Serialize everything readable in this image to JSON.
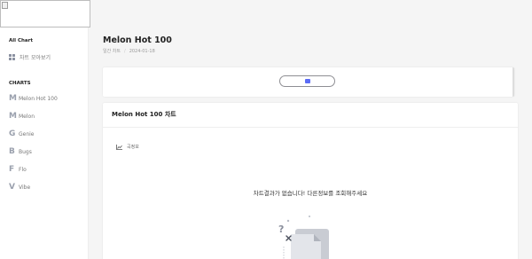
{
  "sidebar": {
    "all_chart_heading": "All Chart",
    "chart_overview_label": "차트 모아보기",
    "charts_heading": "CHARTS",
    "items": [
      {
        "letter": "M",
        "label": "Melon Hot 100"
      },
      {
        "letter": "M",
        "label": "Melon"
      },
      {
        "letter": "G",
        "label": "Genie"
      },
      {
        "letter": "B",
        "label": "Bugs"
      },
      {
        "letter": "F",
        "label": "Flo"
      },
      {
        "letter": "V",
        "label": "Vibe"
      }
    ]
  },
  "header": {
    "title": "Melon Hot 100",
    "breadcrumb_type": "일간 차트",
    "breadcrumb_date": "2024-01-18"
  },
  "chart_card": {
    "title": "Melon Hot 100 차트",
    "info_label": "곡정보",
    "empty_message": "차트결과가 없습니다! 다른정보를 조회해주세요"
  },
  "colors": {
    "accent": "#5b6cf6",
    "sidebar_letter": "#9aa0ad",
    "background": "#f5f5f5"
  }
}
